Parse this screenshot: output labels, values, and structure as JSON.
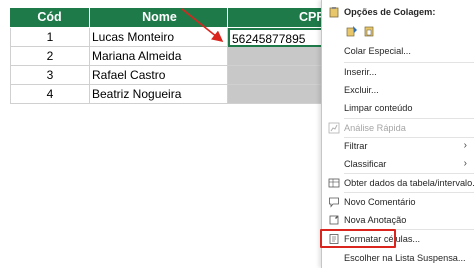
{
  "table": {
    "headers": {
      "cod": "Cód",
      "nome": "Nome",
      "cpf": "CPF"
    },
    "rows": [
      {
        "cod": "1",
        "nome": "Lucas Monteiro",
        "cpf": "56245877895"
      },
      {
        "cod": "2",
        "nome": "Mariana Almeida",
        "cpf": ""
      },
      {
        "cod": "3",
        "nome": "Rafael Castro",
        "cpf": ""
      },
      {
        "cod": "4",
        "nome": "Beatriz Nogueira",
        "cpf": ""
      }
    ]
  },
  "colors": {
    "header_bg": "#1f7a4a",
    "header_text": "#ffffff",
    "selection_border": "#1f7a4a",
    "filled_gray": "#c8c8c8",
    "annotation_red": "#d9251d"
  },
  "context_menu": {
    "paste_options_title": "Opções de Colagem:",
    "items": {
      "paste_special": "Colar Especial...",
      "insert": "Inserir...",
      "delete": "Excluir...",
      "clear_contents": "Limpar conteúdo",
      "quick_analysis": "Análise Rápida",
      "filter": "Filtrar",
      "sort": "Classificar",
      "get_data": "Obter dados da tabela/intervalo...",
      "new_comment": "Novo Comentário",
      "new_note": "Nova Anotação",
      "format_cells": "Formatar células...",
      "pick_from_list": "Escolher na Lista Suspensa..."
    },
    "icons": {
      "paste_options": "clipboard-icon",
      "paste_format": "paste-brush-icon",
      "paste_values": "paste-values-icon",
      "quick_analysis": "quick-analysis-icon",
      "get_data": "table-grid-icon",
      "new_comment": "comment-icon",
      "new_note": "note-icon",
      "format_cells": "format-cells-icon"
    },
    "submenu_chevron": "›"
  }
}
